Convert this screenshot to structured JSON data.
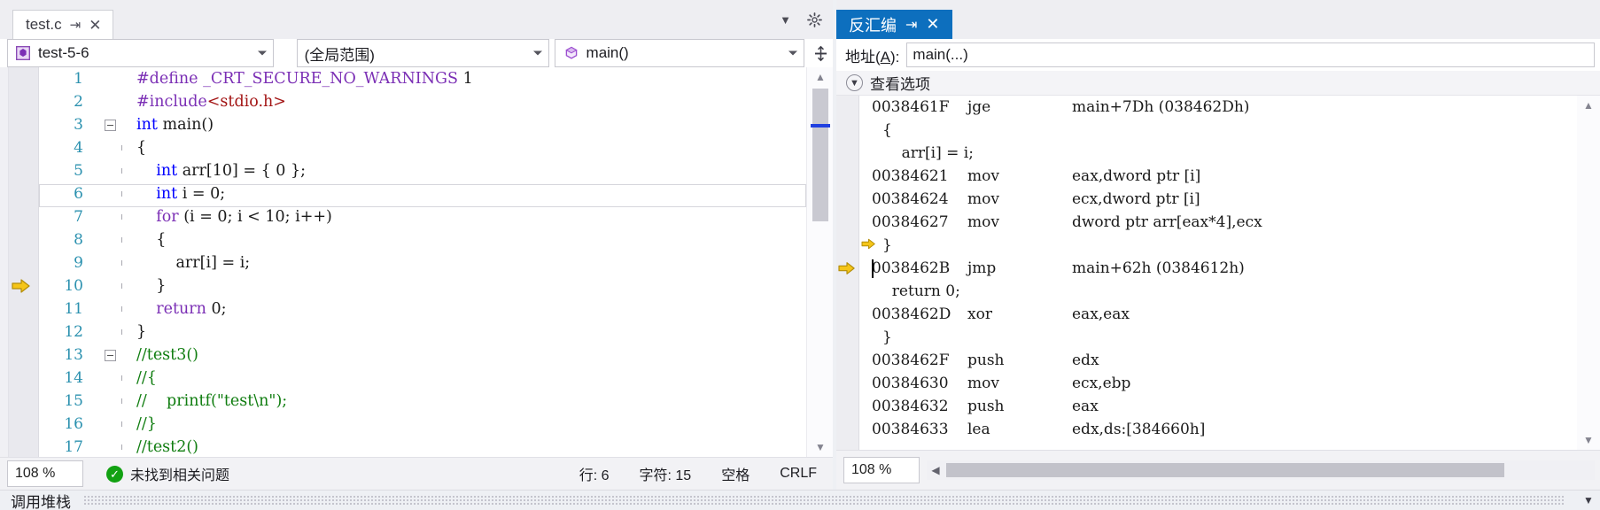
{
  "editor": {
    "tab": {
      "label": "test.c",
      "pin_icon": "pin-icon",
      "close_icon": "close-icon"
    },
    "tabstrip_caret_icon": "chevron-down-icon",
    "gear_icon": "gear-icon",
    "combo_project": {
      "value": "test-5-6",
      "icon": "project-icon"
    },
    "combo_scope": {
      "value": "(全局范围)"
    },
    "combo_function": {
      "value": "main()",
      "icon": "method-icon"
    },
    "split_icon": "split-window-icon",
    "current_line_number": 6,
    "exec_arrow_line": 10,
    "lines": [
      {
        "n": "1",
        "fold": "",
        "bar": "",
        "html": "<span class=\"pp\">#define</span> <span class=\"kw2\">_CRT_SECURE_NO_WARNINGS</span> 1",
        "text": "#define _CRT_SECURE_NO_WARNINGS 1"
      },
      {
        "n": "2",
        "fold": "",
        "bar": "",
        "html": "<span class=\"pp\">#include</span><span class=\"str\">&lt;stdio.h&gt;</span>",
        "text": "#include<stdio.h>"
      },
      {
        "n": "3",
        "fold": "open",
        "bar": "",
        "html": "<span class=\"kw\">int</span> main()",
        "text": "int main()"
      },
      {
        "n": "4",
        "fold": "",
        "bar": "solid",
        "html": "{",
        "text": "{"
      },
      {
        "n": "5",
        "fold": "",
        "bar": "solid",
        "html": "&nbsp;&nbsp;&nbsp;&nbsp;<span class=\"kw\">int</span> arr[10] = { 0 };",
        "text": "    int arr[10] = { 0 };"
      },
      {
        "n": "6",
        "fold": "",
        "bar": "solid",
        "html": "&nbsp;&nbsp;&nbsp;&nbsp;<span class=\"kw\">int</span> i = 0;",
        "text": "    int i = 0;"
      },
      {
        "n": "7",
        "fold": "",
        "bar": "solid",
        "html": "&nbsp;&nbsp;&nbsp;&nbsp;<span class=\"kw2\">for</span> (i = 0; i &lt; 10; i++)",
        "text": "    for (i = 0; i < 10; i++)"
      },
      {
        "n": "8",
        "fold": "",
        "bar": "solid",
        "html": "&nbsp;&nbsp;&nbsp;&nbsp;{",
        "text": "    {"
      },
      {
        "n": "9",
        "fold": "",
        "bar": "solid",
        "html": "&nbsp;&nbsp;&nbsp;&nbsp;&nbsp;&nbsp;&nbsp;&nbsp;arr[i] = i;",
        "text": "        arr[i] = i;"
      },
      {
        "n": "10",
        "fold": "",
        "bar": "solid",
        "html": "&nbsp;&nbsp;&nbsp;&nbsp;}",
        "text": "    }"
      },
      {
        "n": "11",
        "fold": "",
        "bar": "solid",
        "html": "&nbsp;&nbsp;&nbsp;&nbsp;<span class=\"kw2\">return</span> 0;",
        "text": "    return 0;"
      },
      {
        "n": "12",
        "fold": "",
        "bar": "solid",
        "html": "}",
        "text": "}"
      },
      {
        "n": "13",
        "fold": "open",
        "bar": "",
        "html": "<span class=\"cmt\">//test3()</span>",
        "text": "//test3()"
      },
      {
        "n": "14",
        "fold": "",
        "bar": "solid",
        "html": "<span class=\"cmt\">//{</span>",
        "text": "//{"
      },
      {
        "n": "15",
        "fold": "",
        "bar": "solid",
        "html": "<span class=\"cmt\">//&nbsp;&nbsp;&nbsp;&nbsp;printf(\"test\\n\");</span>",
        "text": "//    printf(\"test\\n\");"
      },
      {
        "n": "16",
        "fold": "",
        "bar": "solid",
        "html": "<span class=\"cmt\">//}</span>",
        "text": "//}"
      },
      {
        "n": "17",
        "fold": "",
        "bar": "solid",
        "html": "<span class=\"cmt\">//test2()</span>",
        "text": "//test2()"
      }
    ],
    "status": {
      "zoom": "108 %",
      "ok_icon": "check-circle-icon",
      "message": "未找到相关问题",
      "line_label": "行: 6",
      "char_label": "字符: 15",
      "space_label": "空格",
      "eol_label": "CRLF"
    },
    "scroll": {
      "up_icon": "scroll-up-icon",
      "down_icon": "scroll-down-icon"
    }
  },
  "disassembly": {
    "tab": {
      "label": "反汇编",
      "pin_icon": "pin-icon",
      "close_icon": "close-icon"
    },
    "address": {
      "label_prefix": "地址(",
      "label_key": "A",
      "label_suffix": "):",
      "value": "main(...)"
    },
    "view_options": {
      "label": "查看选项",
      "chevron_icon": "chevron-down-icon"
    },
    "rows": [
      {
        "kind": "asm",
        "addr": "0038461F",
        "mn": "jge",
        "op": "main+7Dh (038462Dh)",
        "arrow": false,
        "cursor": false
      },
      {
        "kind": "src",
        "text": "{",
        "indent": 1,
        "arrow": false
      },
      {
        "kind": "src",
        "text": "    arr[i] = i;",
        "indent": 1,
        "arrow": false
      },
      {
        "kind": "asm",
        "addr": "00384621",
        "mn": "mov",
        "op": "eax,dword ptr [i]",
        "arrow": false,
        "cursor": false
      },
      {
        "kind": "asm",
        "addr": "00384624",
        "mn": "mov",
        "op": "ecx,dword ptr [i]",
        "arrow": false,
        "cursor": false
      },
      {
        "kind": "asm",
        "addr": "00384627",
        "mn": "mov",
        "op": "dword ptr arr[eax*4],ecx",
        "arrow": false,
        "cursor": false
      },
      {
        "kind": "src",
        "text": "}",
        "indent": 1,
        "arrow": true,
        "inline_arrow": true
      },
      {
        "kind": "asm",
        "addr": "0038462B",
        "mn": "jmp",
        "op": "main+62h (0384612h)",
        "arrow": true,
        "cursor": true
      },
      {
        "kind": "src",
        "text": "  return 0;",
        "indent": 1,
        "arrow": false
      },
      {
        "kind": "asm",
        "addr": "0038462D",
        "mn": "xor",
        "op": "eax,eax",
        "arrow": false,
        "cursor": false
      },
      {
        "kind": "src",
        "text": "}",
        "indent": 0,
        "arrow": false
      },
      {
        "kind": "asm",
        "addr": "0038462F",
        "mn": "push",
        "op": "edx",
        "arrow": false,
        "cursor": false
      },
      {
        "kind": "asm",
        "addr": "00384630",
        "mn": "mov",
        "op": "ecx,ebp",
        "arrow": false,
        "cursor": false
      },
      {
        "kind": "asm",
        "addr": "00384632",
        "mn": "push",
        "op": "eax",
        "arrow": false,
        "cursor": false
      },
      {
        "kind": "asm",
        "addr": "00384633",
        "mn": "lea",
        "op": "edx,ds:[384660h]",
        "arrow": false,
        "cursor": false
      }
    ],
    "status": {
      "zoom": "108 %",
      "hscroll_left_icon": "scroll-left-icon"
    },
    "scroll": {
      "up_icon": "scroll-up-icon",
      "down_icon": "scroll-down-icon"
    }
  },
  "bottom_dock": {
    "title": "调用堆栈",
    "caret_icon": "chevron-down-icon"
  },
  "colors": {
    "tab_active": "#0d6fbe",
    "keyword": "#0000ff",
    "preprocessor": "#7b2fb5",
    "string": "#a31515",
    "comment": "#107d10",
    "line_number": "#2b91af",
    "exec_arrow": "#f5c518",
    "ok_green": "#12a112"
  }
}
